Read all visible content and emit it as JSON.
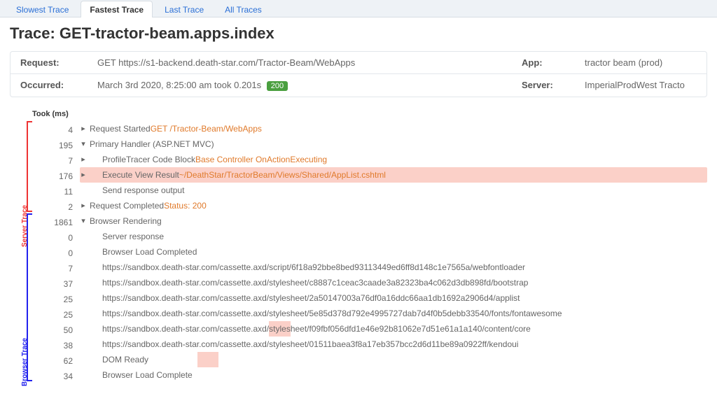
{
  "tabs": [
    {
      "label": "Slowest Trace",
      "active": false
    },
    {
      "label": "Fastest Trace",
      "active": true
    },
    {
      "label": "Last Trace",
      "active": false
    },
    {
      "label": "All Traces",
      "active": false
    }
  ],
  "title": "Trace: GET-tractor-beam.apps.index",
  "meta": {
    "request_label": "Request:",
    "request_value": "GET https://s1-backend.death-star.com/Tractor-Beam/WebApps",
    "app_label": "App:",
    "app_value": "tractor beam (prod)",
    "occurred_label": "Occurred:",
    "occurred_value": "March 3rd 2020, 8:25:00 am took 0.201s",
    "status_pill": "200",
    "server_label": "Server:",
    "server_value": "ImperialProdWest Tracto"
  },
  "took_header": "Took (ms)",
  "gutter": {
    "server": "Server Trace",
    "browser": "Browser Trace"
  },
  "rows": [
    {
      "ms": "4",
      "chev": ">",
      "indent": 0,
      "segments": [
        {
          "t": "Request Started ",
          "c": ""
        },
        {
          "t": "GET /Tractor-Beam/WebApps",
          "c": "orange"
        }
      ]
    },
    {
      "ms": "195",
      "chev": "v",
      "indent": 0,
      "segments": [
        {
          "t": "Primary Handler (ASP.NET MVC)",
          "c": ""
        }
      ]
    },
    {
      "ms": "7",
      "chev": ">",
      "indent": 1,
      "segments": [
        {
          "t": "ProfileTracer Code Block ",
          "c": ""
        },
        {
          "t": "Base Controller OnActionExecuting",
          "c": "orange"
        }
      ]
    },
    {
      "ms": "176",
      "chev": ">",
      "indent": 1,
      "hl": true,
      "segments": [
        {
          "t": "Execute View Result   ",
          "c": ""
        },
        {
          "t": "~/DeathStar/TractorBeam/Views/Shared/AppList.cshtml",
          "c": "orange"
        }
      ]
    },
    {
      "ms": "11",
      "chev": "",
      "indent": 1,
      "segments": [
        {
          "t": "Send response output",
          "c": ""
        }
      ]
    },
    {
      "ms": "2",
      "chev": ">",
      "indent": 0,
      "segments": [
        {
          "t": "Request Completed ",
          "c": ""
        },
        {
          "t": "Status: 200",
          "c": "orange"
        }
      ]
    },
    {
      "ms": "1861",
      "chev": "v",
      "indent": 0,
      "segments": [
        {
          "t": "Browser Rendering",
          "c": ""
        }
      ]
    },
    {
      "ms": "0",
      "chev": "",
      "indent": 1,
      "segments": [
        {
          "t": "Server response",
          "c": ""
        }
      ]
    },
    {
      "ms": "0",
      "chev": "",
      "indent": 1,
      "segments": [
        {
          "t": "Browser Load Completed",
          "c": ""
        }
      ]
    },
    {
      "ms": "7",
      "chev": "",
      "indent": 1,
      "segments": [
        {
          "t": "https://sandbox.death-star.com/cassette.axd/script/6f18a92bbe8bed93113449ed6ff8d148c1e7565a/webfontloader",
          "c": ""
        }
      ]
    },
    {
      "ms": "37",
      "chev": "",
      "indent": 1,
      "segments": [
        {
          "t": "https://sandbox.death-star.com/cassette.axd/stylesheet/c8887c1ceac3caade3a82323ba4c062d3db898fd/bootstrap",
          "c": ""
        }
      ]
    },
    {
      "ms": "25",
      "chev": "",
      "indent": 1,
      "segments": [
        {
          "t": "https://sandbox.death-star.com/cassette.axd/stylesheet/2a50147003a76df0a16ddc66aa1db1692a2906d4/applist",
          "c": ""
        }
      ]
    },
    {
      "ms": "25",
      "chev": "",
      "indent": 1,
      "segments": [
        {
          "t": "https://sandbox.death-star.com/cassette.axd/stylesheet/5e85d378d792e4995727dab7d4f0b5debb33540/fonts/fontawesome",
          "c": ""
        }
      ]
    },
    {
      "ms": "50",
      "chev": "",
      "indent": 1,
      "segments": [
        {
          "t": "https://sandbox.death-star.com/cassette.axd/",
          "c": ""
        },
        {
          "t": "styles",
          "c": "hl-seg"
        },
        {
          "t": "heet/f09fbf056dfd1e46e92b81062e7d51e61a1a140/content/core",
          "c": ""
        }
      ]
    },
    {
      "ms": "38",
      "chev": "",
      "indent": 1,
      "segments": [
        {
          "t": "https://sandbox.death-star.com/cassette.axd/stylesheet/01511baea3f8a17eb357bcc2d6d11be89a0922ff/kendoui",
          "c": ""
        }
      ]
    },
    {
      "ms": "62",
      "chev": "",
      "indent": 1,
      "segments": [
        {
          "t": "DOM Ready",
          "c": ""
        },
        {
          "t": "                     ",
          "c": ""
        },
        {
          "t": "         ",
          "c": "hl-seg"
        }
      ]
    },
    {
      "ms": "34",
      "chev": "",
      "indent": 1,
      "segments": [
        {
          "t": "Browser Load Complete",
          "c": ""
        }
      ]
    }
  ]
}
